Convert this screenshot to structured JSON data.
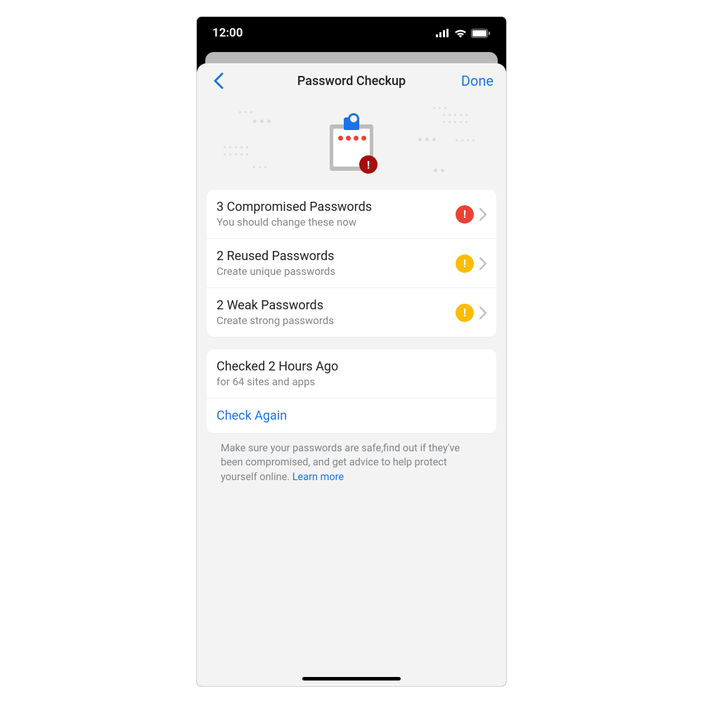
{
  "statusbar": {
    "time": "12:00"
  },
  "nav": {
    "title": "Password Checkup",
    "done": "Done"
  },
  "issues": [
    {
      "title": "3 Compromised Passwords",
      "subtitle": "You should change these now",
      "severity": "red"
    },
    {
      "title": "2 Reused Passwords",
      "subtitle": "Create unique passwords",
      "severity": "yellow"
    },
    {
      "title": "2 Weak Passwords",
      "subtitle": "Create strong passwords",
      "severity": "yellow"
    }
  ],
  "status": {
    "title": "Checked 2 Hours Ago",
    "subtitle": "for 64 sites and apps",
    "action": "Check Again"
  },
  "footer": {
    "text": "Make sure your passwords are safe,find out if they've been compromised, and get advice to help protect yourself online. ",
    "link": "Learn more"
  }
}
